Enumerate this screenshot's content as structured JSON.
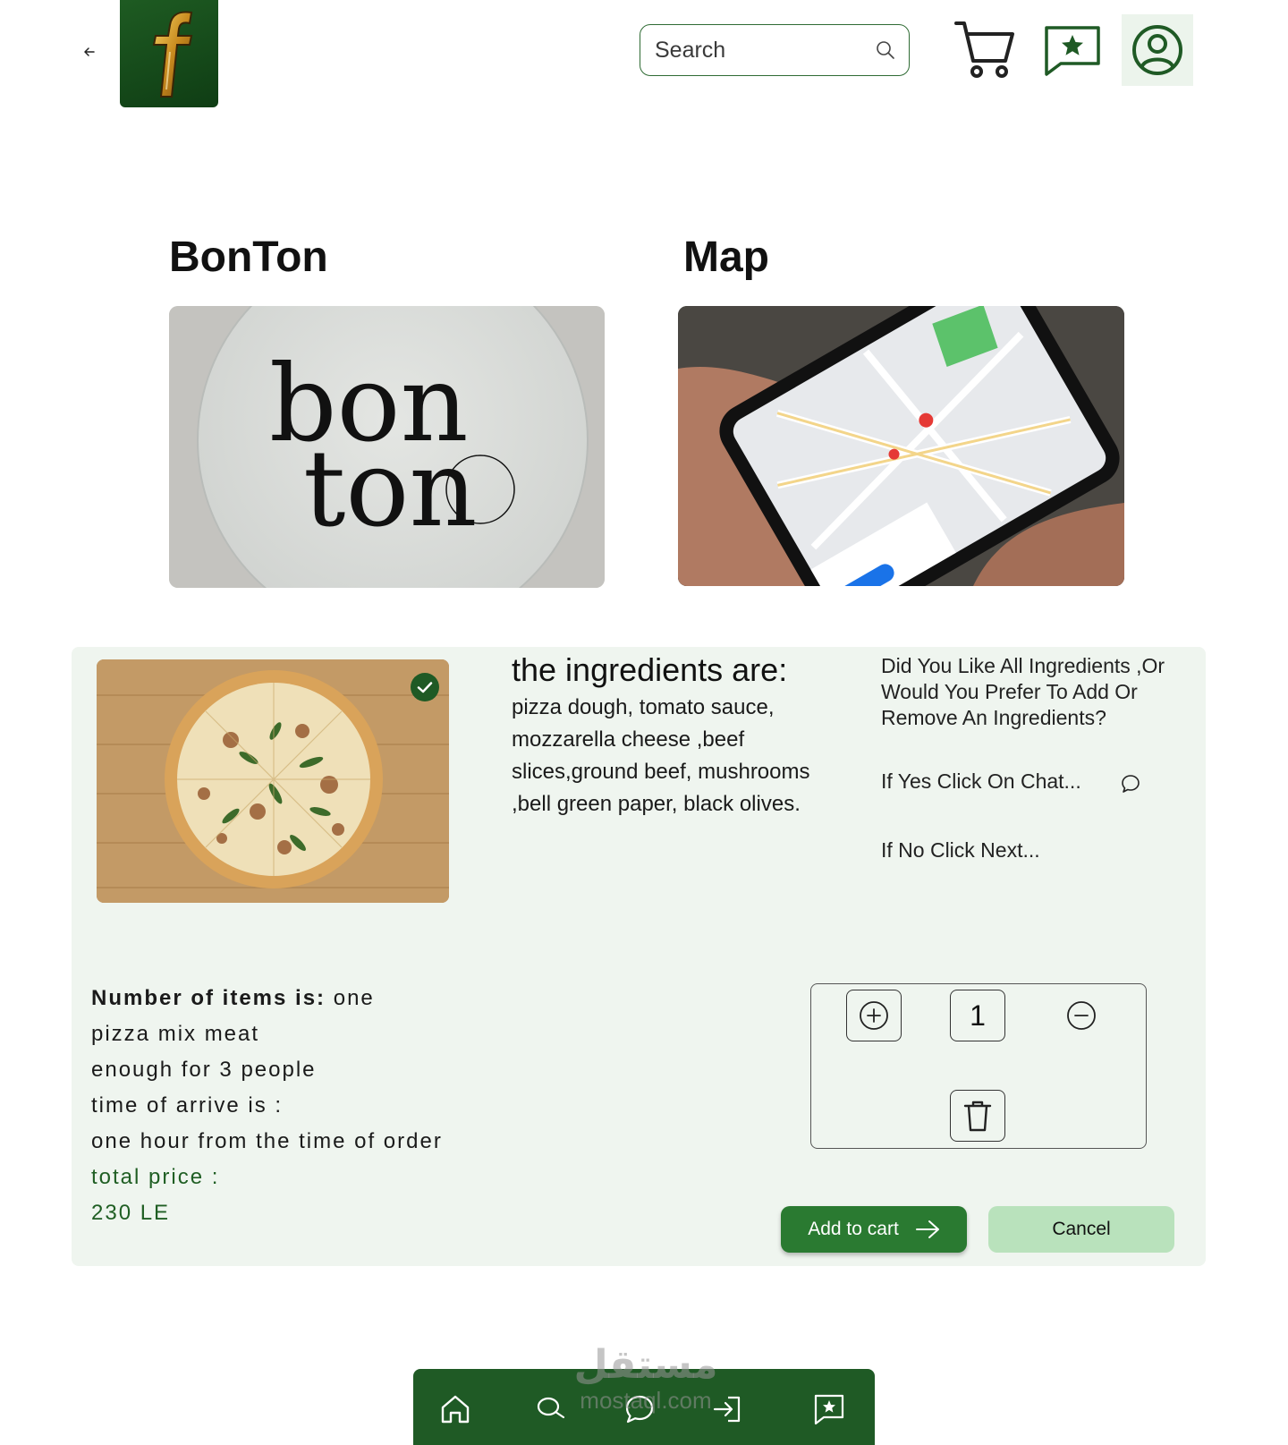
{
  "header": {
    "search_placeholder": "Search",
    "icons": [
      "back-arrow-icon",
      "logo-f-icon",
      "search-icon",
      "cart-icon",
      "favorites-star-icon",
      "user-profile-icon"
    ]
  },
  "sections": {
    "restaurant_title": "BonTon",
    "map_title": "Map"
  },
  "order": {
    "ingredients_title": "the ingredients are:",
    "ingredients_text": "pizza dough, tomato sauce, mozzarella cheese ,beef slices,ground beef, mushrooms ,bell green paper, black olives.",
    "question": "Did You Like All Ingredients ,Or Would You Prefer To Add Or Remove An Ingredients?",
    "chat_prompt": "If Yes Click On Chat...",
    "next_prompt": "If No Click Next...",
    "items_label": "Number of items is:",
    "items_value": "one",
    "item_name": "pizza mix meat",
    "serving": "enough for 3 people",
    "arrive_label": "time of arrive is :",
    "arrive_value": "one hour from the time of order",
    "price_label": "total price :",
    "price_value": "230 LE",
    "quantity": "1",
    "add_to_cart": "Add to cart",
    "cancel": "Cancel"
  },
  "bottom_nav": {
    "icons": [
      "home-icon",
      "search-icon",
      "chat-icon",
      "login-icon",
      "favorites-star-icon"
    ]
  },
  "watermark": {
    "arabic": "مستقل",
    "latin": "mostaql.com"
  },
  "colors": {
    "primary_green": "#2a7a31",
    "dark_green": "#1f5a25",
    "panel_bg": "#eff5ef",
    "cancel_bg": "#b9e2bc"
  }
}
